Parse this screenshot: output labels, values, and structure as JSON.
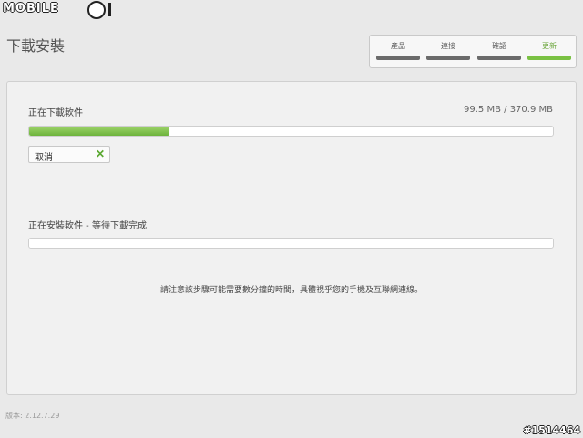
{
  "watermark": {
    "logo_text": "MOBILE",
    "post_id": "#1514464"
  },
  "window": {
    "title": "下載安裝"
  },
  "steps": [
    {
      "label": "產品",
      "active": false
    },
    {
      "label": "連接",
      "active": false
    },
    {
      "label": "確認",
      "active": false
    },
    {
      "label": "更新",
      "active": true
    }
  ],
  "download": {
    "label": "正在下載軟件",
    "size_text": "99.5 MB / 370.9 MB",
    "progress": 0.268,
    "cancel_label": "取消",
    "cancel_icon": "close-icon"
  },
  "install": {
    "label": "正在安裝軟件 - 等待下載完成",
    "progress": 0.0
  },
  "notice": "請注意該步驟可能需要數分鐘的時間，具體視乎您的手機及互聯網速線。",
  "version": "版本: 2.12.7.29",
  "colors": {
    "accent": "#7ac143",
    "step_inactive": "#6b6b6b",
    "background": "#e9e9e9"
  }
}
